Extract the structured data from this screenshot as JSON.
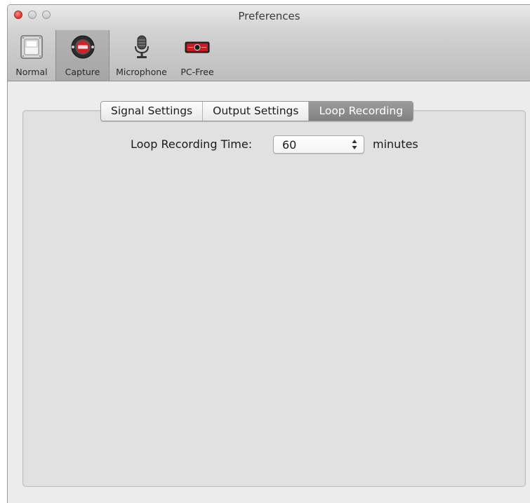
{
  "window": {
    "title": "Preferences"
  },
  "toolbar": {
    "items": [
      {
        "label": "Normal",
        "icon": "switch-icon",
        "selected": false
      },
      {
        "label": "Capture",
        "icon": "record-button-icon",
        "selected": true
      },
      {
        "label": "Microphone",
        "icon": "microphone-icon",
        "selected": false
      },
      {
        "label": "PC-Free",
        "icon": "capture-device-icon",
        "selected": false
      }
    ]
  },
  "tabs": [
    {
      "label": "Signal Settings",
      "active": false
    },
    {
      "label": "Output Settings",
      "active": false
    },
    {
      "label": "Loop Recording",
      "active": true
    }
  ],
  "loop": {
    "label": "Loop Recording Time:",
    "value": "60",
    "unit": "minutes"
  },
  "colors": {
    "close": "#e0443e",
    "capture_red": "#d71f25",
    "active_tab": "#8c8c8c"
  }
}
